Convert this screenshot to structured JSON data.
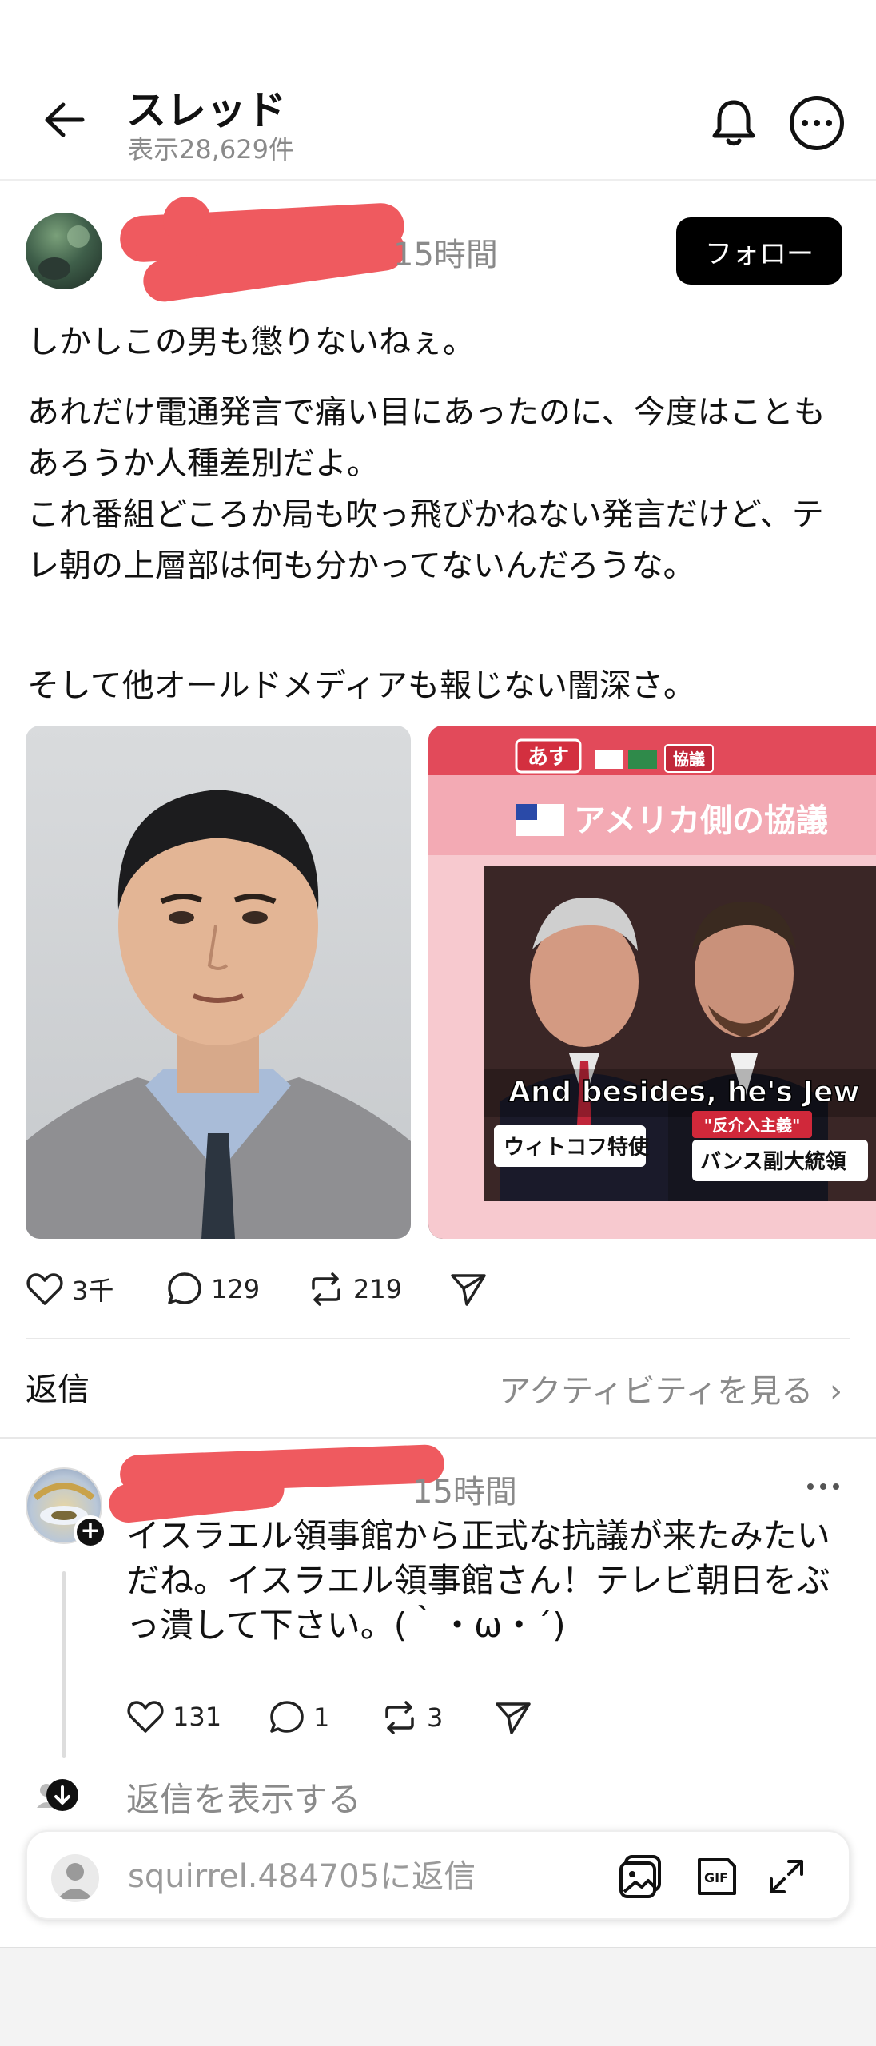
{
  "header": {
    "title": "スレッド",
    "subtitle": "表示28,629件",
    "icons": {
      "back": "arrow-left-icon",
      "notifications": "bell-icon",
      "more": "more-horizontal-icon"
    }
  },
  "post": {
    "time": "15時間",
    "follow_label": "フォロー",
    "paragraphs": [
      "しかしこの男も懲りないねぇ。",
      "あれだけ電通発言で痛い目にあったのに、今度はこともあろうか人種差別だよ。\nこれ番組どころか局も吹っ飛びかねない発言だけど、テレ朝の上層部は何も分かってないんだろうな。",
      "そして他オールドメディアも報じない闇深さ。"
    ],
    "images": [
      {
        "alt": "スーツ姿の男性のポートレート"
      },
      {
        "tv_banner": "アメリカ側の協議",
        "top_tags": [
          "あす",
          "協議"
        ],
        "subtitle_caption": "And besides, he's Jew",
        "name_plates": [
          "ウィトコフ特使",
          "バンス副大統領"
        ],
        "red_plate": "\"反介入主義\""
      }
    ],
    "actions": {
      "likes": "3千",
      "comments": "129",
      "reposts": "219"
    }
  },
  "replies_header": {
    "label": "返信",
    "activity_link": "アクティビティを見る"
  },
  "reply": {
    "time": "15時間",
    "text": "イスラエル領事館から正式な抗議が来たみたいだね。イスラエル領事館さん！テレビ朝日をぶっ潰して下さい。(｀・ω・´)",
    "actions": {
      "likes": "131",
      "comments": "1",
      "reposts": "3"
    },
    "show_replies": "返信を表示する"
  },
  "composer": {
    "placeholder": "squirrel.484705に返信",
    "icons": [
      "image-icon",
      "gif-icon",
      "expand-icon"
    ]
  },
  "colors": {
    "redaction": "#ef5a5f",
    "muted_text": "#8a8a8a",
    "follow_bg": "#000000"
  }
}
